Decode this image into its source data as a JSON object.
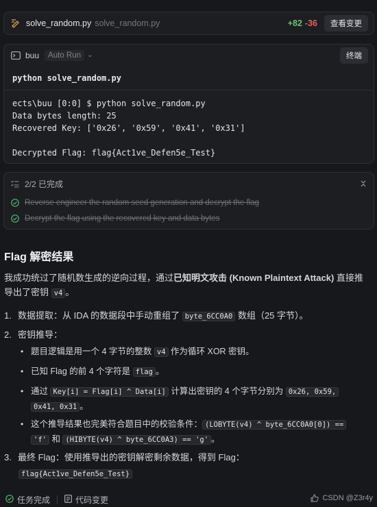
{
  "file": {
    "name": "solve_random.py",
    "path": "solve_random.py",
    "added": "+82",
    "removed": "-36",
    "view_button": "查看变更"
  },
  "terminal": {
    "name": "buu",
    "mode": "Auto Run",
    "stop_button": "终端",
    "command": "python solve_random.py",
    "output": [
      "ects\\buu [0:0] $ python solve_random.py",
      "Data bytes length: 25",
      "Recovered Key: ['0x26', '0x59', '0x41', '0x31']",
      "",
      "Decrypted Flag: flag{Act1ve_Defen5e_Test}"
    ]
  },
  "tasks": {
    "summary": "2/2 已完成",
    "items": [
      "Reverse engineer the random seed generation and decrypt the flag",
      "Decrypt the flag using the recovered key and data bytes"
    ]
  },
  "content": {
    "title": "Flag 解密结果",
    "intro_a": "我成功统过了随机数生成的逆向过程，通过",
    "intro_bold": "已知明文攻击 (Known Plaintext Attack)",
    "intro_b": " 直接推",
    "intro_c": "导出了密钥 ",
    "intro_code": "v4",
    "intro_end": "。",
    "step1_num": "1.",
    "step1_a": "数据提取：从 IDA 的数据段中手动重组了 ",
    "step1_code": "byte_6CC0A0",
    "step1_b": " 数组（25 字节）。",
    "step2_num": "2.",
    "step2": "密钥推导：",
    "b1_a": "题目逻辑是用一个 4 字节的整数 ",
    "b1_code": "v4",
    "b1_b": " 作为循环 XOR 密钥。",
    "b2_a": "已知 Flag 的前 4 个字符是 ",
    "b2_code": "flag",
    "b2_b": "。",
    "b3_a": "通过 ",
    "b3_code": "Key[i] = Flag[i] ^ Data[i]",
    "b3_b": " 计算出密钥的 4 个字节分别为 ",
    "b3_code2": "0x26, 0x59,",
    "b3_code3": "0x41, 0x31",
    "b3_c": "。",
    "b4_a": "这个推导结果也完美符合题目中的校验条件：",
    "b4_code": "(LOBYTE(v4) ^ byte_6CC0A0[0]) ==",
    "b4_code2": "'f'",
    "b4_mid": " 和 ",
    "b4_code3": "(HIBYTE(v4) ^ byte_6CC0A3) == 'g'",
    "b4_end": "。",
    "step3_num": "3.",
    "step3": "最终 Flag：使用推导出的密钥解密剩余数据，得到 Flag：",
    "flag": "flag{Act1ve_Defen5e_Test}"
  },
  "footer": {
    "task_done": "任务完成",
    "code_change": "代码变更",
    "watermark": "CSDN @Z3r4y"
  }
}
